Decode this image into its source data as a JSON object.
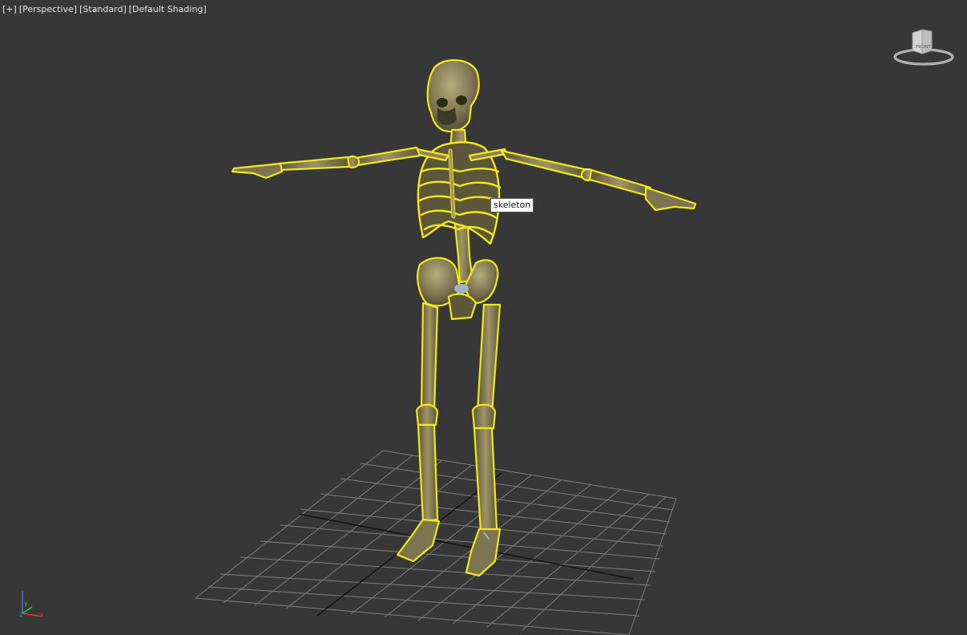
{
  "viewport": {
    "labels": {
      "menu": "[+]",
      "view": "[Perspective]",
      "style": "[Standard]",
      "shading": "[Default Shading]"
    },
    "tooltip": "skeleton",
    "selected_object": "skeleton",
    "viewcube": {
      "face_label": "FRONT"
    },
    "axis_tripod": {
      "x": "x",
      "y": "y",
      "z": "z"
    },
    "colors": {
      "background": "#373737",
      "selection_outline": "#f2e81e",
      "bone": "#7d7450",
      "grid": "#8a8a8a",
      "grid_axis": "#111111"
    }
  }
}
